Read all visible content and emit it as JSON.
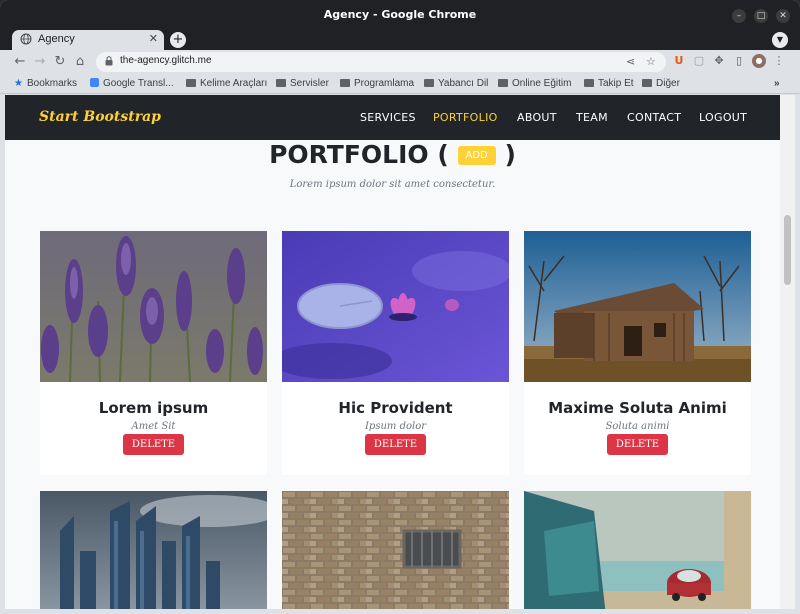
{
  "window": {
    "title": "Agency - Google Chrome"
  },
  "tab": {
    "title": "Agency"
  },
  "address_bar": {
    "url": "the-agency.glitch.me"
  },
  "bookmarks": [
    {
      "label": "Bookmarks",
      "icon": "star-icon"
    },
    {
      "label": "Google Transl...",
      "icon": "google-translate-icon"
    },
    {
      "label": "Kelime Araçları",
      "icon": "folder-icon"
    },
    {
      "label": "Servisler",
      "icon": "folder-icon"
    },
    {
      "label": "Programlama",
      "icon": "folder-icon"
    },
    {
      "label": "Yabancı Dil",
      "icon": "folder-icon"
    },
    {
      "label": "Online Eğitim",
      "icon": "folder-icon"
    },
    {
      "label": "Takip Et",
      "icon": "folder-icon"
    },
    {
      "label": "Diğer",
      "icon": "folder-icon"
    }
  ],
  "site": {
    "brand": "Start Bootstrap",
    "nav": [
      "SERVICES",
      "PORTFOLIO",
      "ABOUT",
      "TEAM",
      "CONTACT",
      "LOGOUT"
    ],
    "accent": "#fed136",
    "dark": "#212529"
  },
  "portfolio": {
    "heading": "PORTFOLIO (",
    "heading_close": ")",
    "add_label": "ADD",
    "subheading": "Lorem ipsum dolor sit amet consectetur.",
    "delete_label": "DELETE",
    "items": [
      {
        "title": "Lorem ipsum",
        "subtitle": "Amet Sit"
      },
      {
        "title": "Hic Provident",
        "subtitle": "Ipsum dolor"
      },
      {
        "title": "Maxime Soluta Animi",
        "subtitle": "Soluta animi"
      }
    ]
  }
}
